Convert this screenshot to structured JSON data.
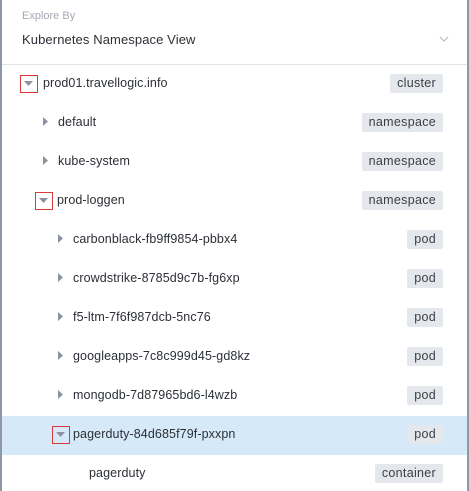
{
  "explore": {
    "label": "Explore By",
    "value": "Kubernetes Namespace View"
  },
  "tree": {
    "rows": [
      {
        "label": "prod01.travellogic.info",
        "badge": "cluster",
        "expanded": true
      },
      {
        "label": "default",
        "badge": "namespace",
        "expanded": false
      },
      {
        "label": "kube-system",
        "badge": "namespace",
        "expanded": false
      },
      {
        "label": "prod-loggen",
        "badge": "namespace",
        "expanded": true
      },
      {
        "label": "carbonblack-fb9ff9854-pbbx4",
        "badge": "pod",
        "expanded": false
      },
      {
        "label": "crowdstrike-8785d9c7b-fg6xp",
        "badge": "pod",
        "expanded": false
      },
      {
        "label": "f5-ltm-7f6f987dcb-5nc76",
        "badge": "pod",
        "expanded": false
      },
      {
        "label": "googleapps-7c8c999d45-gd8kz",
        "badge": "pod",
        "expanded": false
      },
      {
        "label": "mongodb-7d87965bd6-l4wzb",
        "badge": "pod",
        "expanded": false
      },
      {
        "label": "pagerduty-84d685f79f-pxxpn",
        "badge": "pod",
        "expanded": true,
        "selected": true
      },
      {
        "label": "pagerduty",
        "badge": "container",
        "expanded": false
      }
    ]
  },
  "colors": {
    "selected_row": "#d6e9f8",
    "badge_bg": "#e4e8ed",
    "toggle_outline": "#d93b3b",
    "caret": "#8a939f"
  }
}
